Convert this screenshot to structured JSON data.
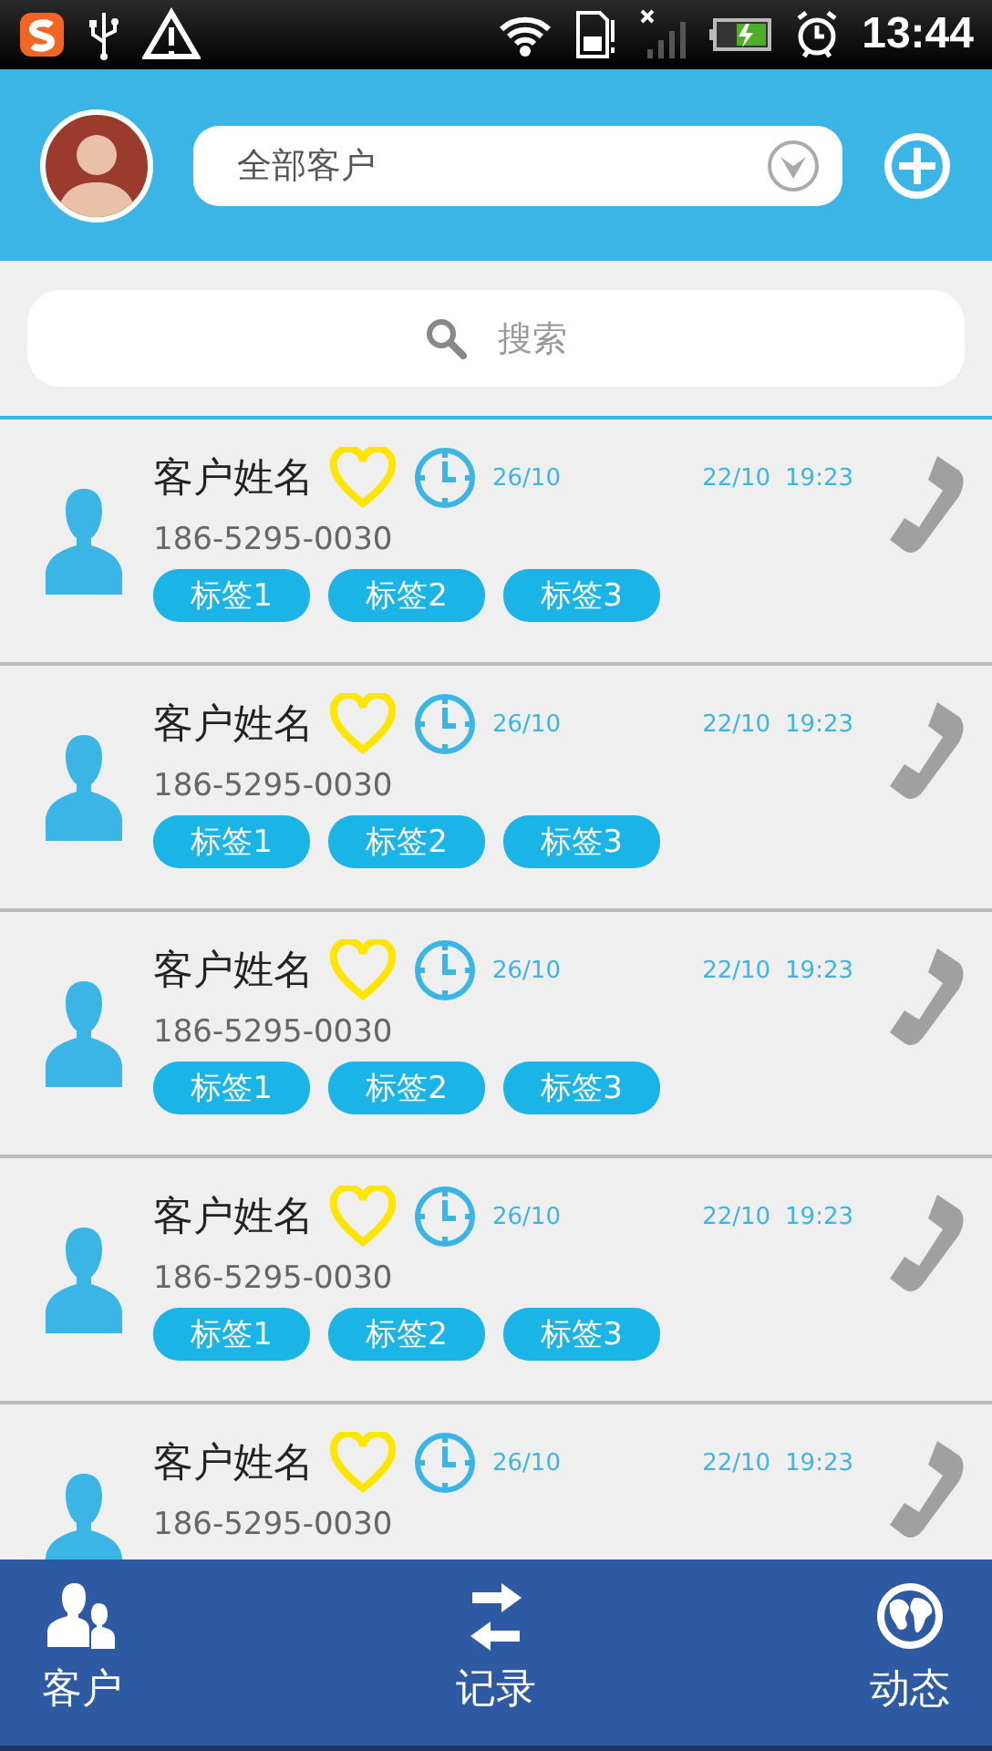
{
  "status_bar": {
    "time": "13:44"
  },
  "header": {
    "filter": "全部客户"
  },
  "search": {
    "placeholder": "搜索"
  },
  "customers": [
    {
      "name": "客户姓名",
      "favorite": true,
      "follow_date": "26/10",
      "date": "22/10",
      "time": "19:23",
      "phone": "186-5295-0030",
      "tags": [
        "标签1",
        "标签2",
        "标签3"
      ]
    },
    {
      "name": "客户姓名",
      "favorite": true,
      "follow_date": "26/10",
      "date": "22/10",
      "time": "19:23",
      "phone": "186-5295-0030",
      "tags": [
        "标签1",
        "标签2",
        "标签3"
      ]
    },
    {
      "name": "客户姓名",
      "favorite": true,
      "follow_date": "26/10",
      "date": "22/10",
      "time": "19:23",
      "phone": "186-5295-0030",
      "tags": [
        "标签1",
        "标签2",
        "标签3"
      ]
    },
    {
      "name": "客户姓名",
      "favorite": true,
      "follow_date": "26/10",
      "date": "22/10",
      "time": "19:23",
      "phone": "186-5295-0030",
      "tags": [
        "标签1",
        "标签2",
        "标签3"
      ]
    },
    {
      "name": "客户姓名",
      "favorite": true,
      "follow_date": "26/10",
      "date": "22/10",
      "time": "19:23",
      "phone": "186-5295-0030"
    }
  ],
  "tabs": [
    {
      "label": "客户",
      "kind": "customers"
    },
    {
      "label": "记录",
      "kind": "records"
    },
    {
      "label": "动态",
      "kind": "news"
    }
  ]
}
